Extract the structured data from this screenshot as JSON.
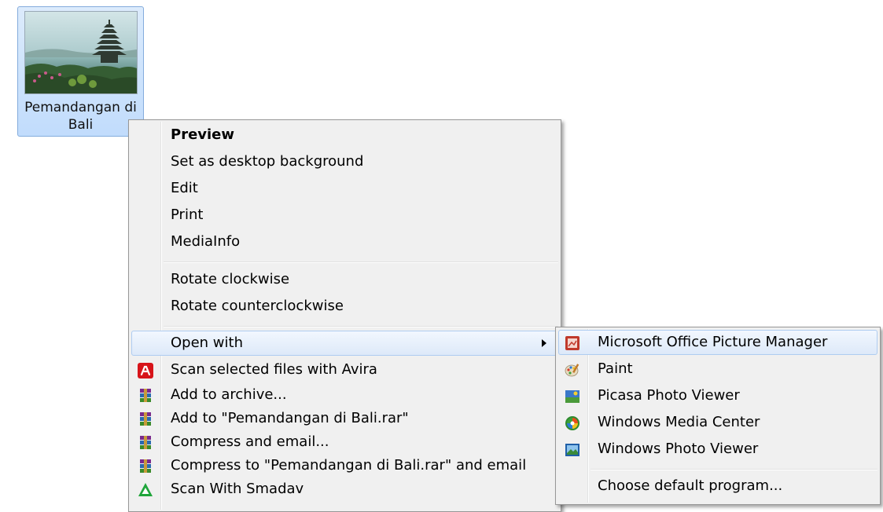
{
  "desktop_icon": {
    "label": "Pemandangan di Bali"
  },
  "context_menu": {
    "items": [
      {
        "label": "Preview",
        "bold": true
      },
      {
        "label": "Set as desktop background"
      },
      {
        "label": "Edit"
      },
      {
        "label": "Print"
      },
      {
        "label": "MediaInfo"
      },
      {
        "label": "Rotate clockwise"
      },
      {
        "label": "Rotate counterclockwise"
      },
      {
        "label": "Open with",
        "submenu": true,
        "highlighted": true
      },
      {
        "label": "Scan selected files with Avira",
        "icon": "avira-icon"
      },
      {
        "label": "Add to archive...",
        "icon": "winrar-icon"
      },
      {
        "label": "Add to \"Pemandangan di Bali.rar\"",
        "icon": "winrar-icon"
      },
      {
        "label": "Compress and email...",
        "icon": "winrar-icon"
      },
      {
        "label": "Compress to \"Pemandangan di Bali.rar\" and email",
        "icon": "winrar-icon"
      },
      {
        "label": "Scan With Smadav",
        "icon": "smadav-icon"
      }
    ]
  },
  "open_with_submenu": {
    "items": [
      {
        "label": "Microsoft Office Picture Manager",
        "icon": "picture-manager-icon",
        "highlighted": true
      },
      {
        "label": "Paint",
        "icon": "paint-icon"
      },
      {
        "label": "Picasa Photo Viewer",
        "icon": "picasa-icon"
      },
      {
        "label": "Windows Media Center",
        "icon": "media-center-icon"
      },
      {
        "label": "Windows Photo Viewer",
        "icon": "photo-viewer-icon"
      },
      {
        "label": "Choose default program..."
      }
    ]
  },
  "colors": {
    "menu_background": "#f0f0f0",
    "highlight_border": "#aeccf1",
    "selection_background": "#c9e0fc"
  }
}
